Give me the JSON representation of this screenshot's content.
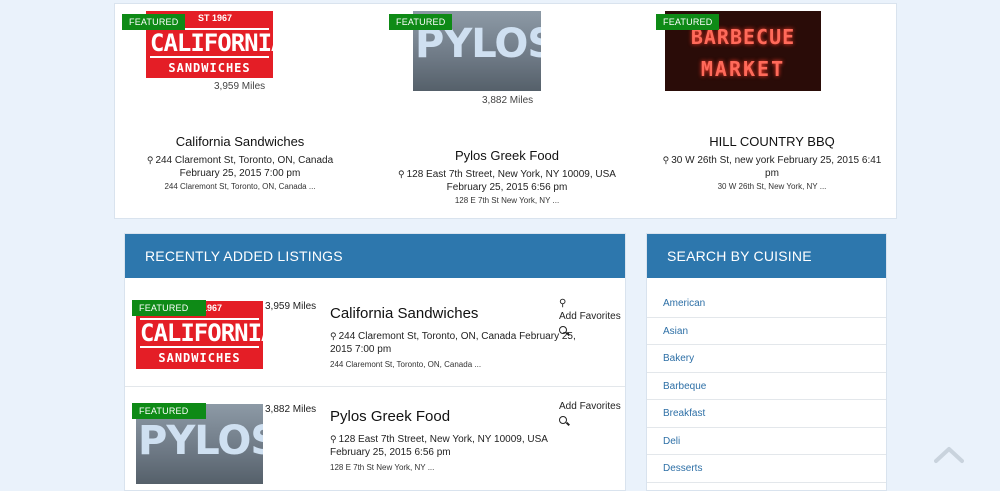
{
  "featured": [
    {
      "badge": "FEATURED",
      "image": "california-sandwiches-sign",
      "image_text": {
        "top": "ST 1967",
        "main": "CALIFORNIA",
        "sub": "SANDWICHES"
      },
      "distance": "3,959 Miles",
      "name": "California Sandwiches",
      "address": "244 Claremont St, Toronto, ON, Canada",
      "date": "February 25, 2015 7:00 pm",
      "short_address": "244 Claremont St, Toronto, ON, Canada ..."
    },
    {
      "badge": "FEATURED",
      "image": "pylos-sign",
      "image_text": {
        "main": "PYLOS"
      },
      "distance": "3,882 Miles",
      "name": "Pylos Greek Food",
      "address": "128 East 7th Street, New York, NY 10009, USA",
      "date": "February 25, 2015 6:56 pm",
      "short_address": "128 E 7th St New York, NY ..."
    },
    {
      "badge": "FEATURED",
      "image": "barbecue-market-neon-sign",
      "image_text": {
        "line1": "BARBECUE",
        "line2": "MARKET"
      },
      "name": "HILL COUNTRY BBQ",
      "address": "30 W 26th St, new york February 25, 2015 6:41 pm",
      "short_address": "30 W 26th St, New York, NY ..."
    }
  ],
  "recent": {
    "title": "RECENTLY ADDED LISTINGS",
    "items": [
      {
        "badge": "FEATURED",
        "distance": "3,959 Miles",
        "name": "California Sandwiches",
        "address": "244 Claremont St, Toronto, ON, Canada February 25, 2015 7:00 pm",
        "short_address": "244 Claremont St, Toronto, ON, Canada ...",
        "fav_label": "Add Favorites"
      },
      {
        "badge": "FEATURED",
        "distance": "3,882 Miles",
        "name": "Pylos Greek Food",
        "address": "128 East 7th Street, New York, NY 10009, USA February 25, 2015 6:56 pm",
        "short_address": "128 E 7th St New York, NY ...",
        "fav_label": "Add Favorites"
      }
    ]
  },
  "cuisine": {
    "title": "SEARCH BY CUISINE",
    "items": [
      "American",
      "Asian",
      "Bakery",
      "Barbeque",
      "Breakfast",
      "Deli",
      "Desserts"
    ]
  },
  "colors": {
    "header": "#2d77ad",
    "badge": "#0e8a16",
    "link": "#2d6fa6"
  },
  "icons": {
    "pin": "map-marker-icon",
    "search": "search-icon",
    "top": "chevron-up-icon"
  }
}
